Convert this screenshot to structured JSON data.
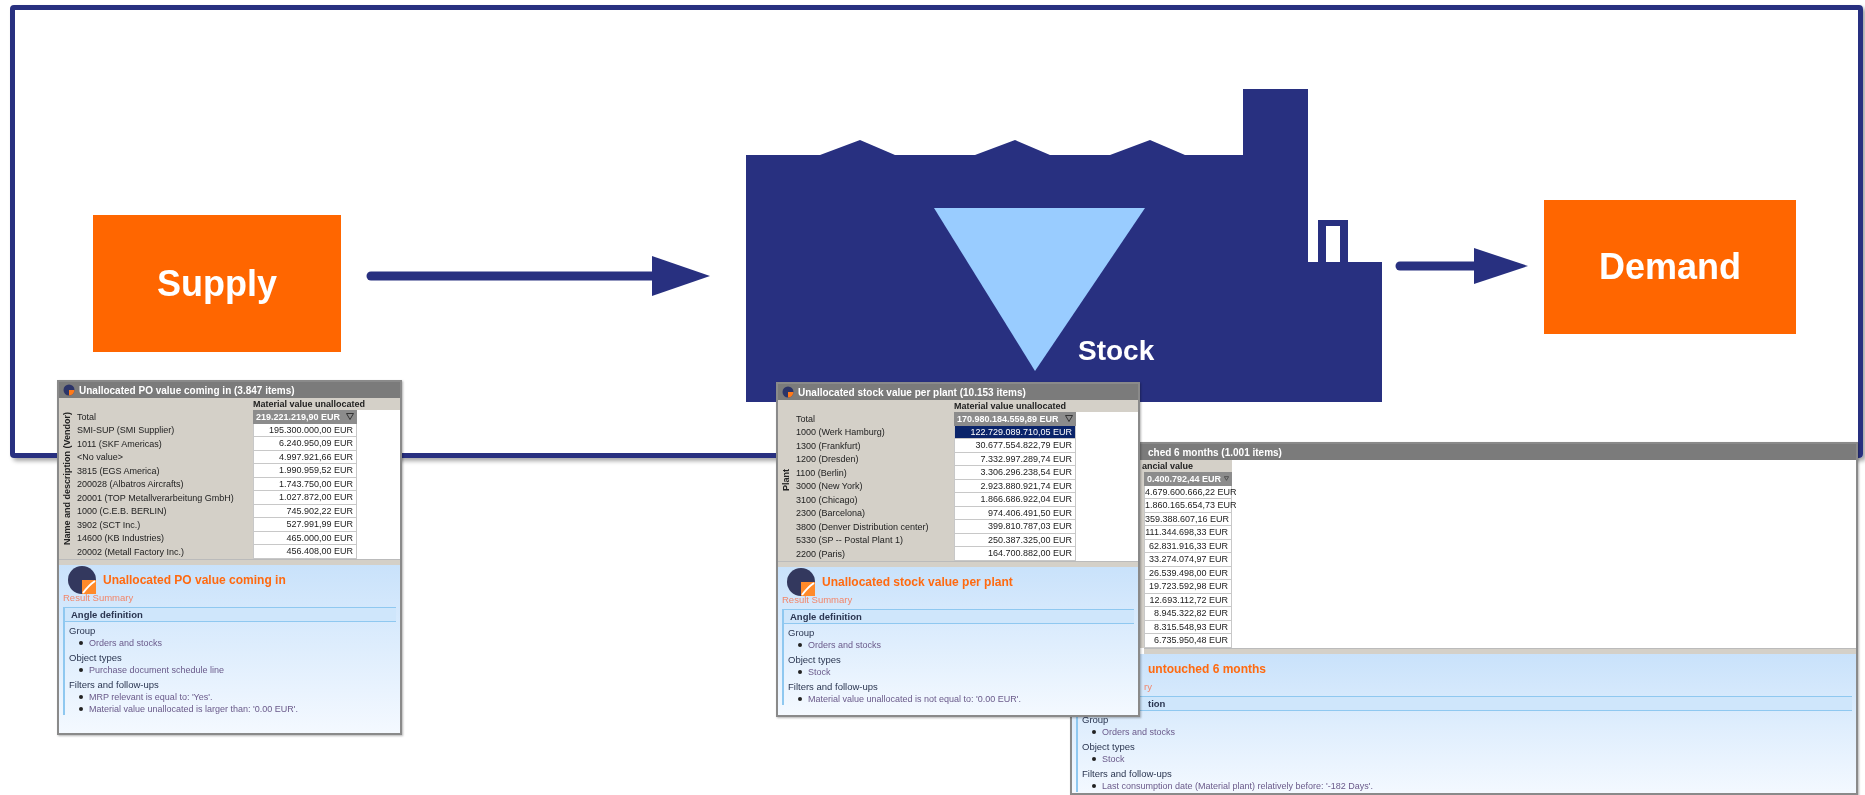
{
  "diagram": {
    "supply": "Supply",
    "stock": "Stock",
    "demand": "Demand"
  },
  "windows": [
    {
      "title": "Unallocated PO value coming in (3.847 items)",
      "axis_label": "Name and description (Vendor)",
      "column_header": "Material value unallocated",
      "total_label": "Total",
      "total": "219.221.219,90 EUR",
      "rows": [
        {
          "label": "SMI-SUP (SMI Supplier)",
          "value": "195.300.000,00 EUR",
          "selected": false
        },
        {
          "label": "1011 (SKF Americas)",
          "value": "6.240.950,09 EUR",
          "selected": false
        },
        {
          "label": "<No value>",
          "value": "4.997.921,66 EUR",
          "selected": false
        },
        {
          "label": "3815 (EGS America)",
          "value": "1.990.959,52 EUR",
          "selected": false
        },
        {
          "label": "200028 (Albatros Aircrafts)",
          "value": "1.743.750,00 EUR",
          "selected": false
        },
        {
          "label": "20001 (TOP Metallverarbeitung GmbH)",
          "value": "1.027.872,00 EUR",
          "selected": false
        },
        {
          "label": "1000 (C.E.B. BERLIN)",
          "value": "745.902,22 EUR",
          "selected": false
        },
        {
          "label": "3902 (SCT Inc.)",
          "value": "527.991,99 EUR",
          "selected": false
        },
        {
          "label": "14600 (KB Industries)",
          "value": "465.000,00 EUR",
          "selected": false
        },
        {
          "label": "20002 (Metall Factory Inc.)",
          "value": "456.408,00 EUR",
          "selected": false
        }
      ],
      "summary": {
        "title": "Unallocated PO value coming in",
        "subtitle": "Result Summary",
        "section": "Angle definition",
        "groups": [
          {
            "heading": "Group",
            "items": [
              "Orders and stocks"
            ]
          },
          {
            "heading": "Object types",
            "items": [
              "Purchase document schedule line"
            ]
          },
          {
            "heading": "Filters and follow-ups",
            "items": [
              "MRP relevant is equal to: 'Yes'.",
              "Material value unallocated is larger than: '0.00 EUR'."
            ]
          }
        ]
      }
    },
    {
      "title": "Unallocated stock value per plant (10.153 items)",
      "axis_label": "Plant",
      "column_header": "Material value unallocated",
      "total_label": "Total",
      "total": "170.980.184.559,89 EUR",
      "rows": [
        {
          "label": "1000 (Werk Hamburg)",
          "value": "122.729.089.710,05 EUR",
          "selected": true
        },
        {
          "label": "1300 (Frankfurt)",
          "value": "30.677.554.822,79 EUR",
          "selected": false
        },
        {
          "label": "1200 (Dresden)",
          "value": "7.332.997.289,74 EUR",
          "selected": false
        },
        {
          "label": "1100 (Berlin)",
          "value": "3.306.296.238,54 EUR",
          "selected": false
        },
        {
          "label": "3000 (New York)",
          "value": "2.923.880.921,74 EUR",
          "selected": false
        },
        {
          "label": "3100 (Chicago)",
          "value": "1.866.686.922,04 EUR",
          "selected": false
        },
        {
          "label": "2300 (Barcelona)",
          "value": "974.406.491,50 EUR",
          "selected": false
        },
        {
          "label": "3800 (Denver Distribution center)",
          "value": "399.810.787,03 EUR",
          "selected": false
        },
        {
          "label": "5330 (SP -- Postal Plant 1)",
          "value": "250.387.325,00 EUR",
          "selected": false
        },
        {
          "label": "2200 (Paris)",
          "value": "164.700.882,00 EUR",
          "selected": false
        }
      ],
      "summary": {
        "title": "Unallocated stock value per plant",
        "subtitle": "Result Summary",
        "section": "Angle definition",
        "groups": [
          {
            "heading": "Group",
            "items": [
              "Orders and stocks"
            ]
          },
          {
            "heading": "Object types",
            "items": [
              "Stock"
            ]
          },
          {
            "heading": "Filters and follow-ups",
            "items": [
              "Material value unallocated is not equal to: '0.00 EUR'."
            ]
          }
        ]
      }
    },
    {
      "title": "ched 6 months (1.001 items)",
      "column_header": "ancial value",
      "total": "0.400.792,44 EUR",
      "rows": [
        {
          "value": "4.679.600.666,22 EUR",
          "selected": false
        },
        {
          "value": "1.860.165.654,73 EUR",
          "selected": false
        },
        {
          "value": "359.388.607,16 EUR",
          "selected": false
        },
        {
          "value": "111.344.698,33 EUR",
          "selected": false
        },
        {
          "value": "62.831.916,33 EUR",
          "selected": false
        },
        {
          "value": "33.274.074,97 EUR",
          "selected": false
        },
        {
          "value": "26.539.498,00 EUR",
          "selected": false
        },
        {
          "value": "19.723.592,98 EUR",
          "selected": false
        },
        {
          "value": "12.693.112,72 EUR",
          "selected": false
        },
        {
          "value": "8.945.322,82 EUR",
          "selected": false
        },
        {
          "value": "8.315.548,93 EUR",
          "selected": false
        },
        {
          "value": "6.735.950,48 EUR",
          "selected": false
        }
      ],
      "summary": {
        "title": "untouched 6 months",
        "subtitle": "ry",
        "section": "tion",
        "groups": [
          {
            "heading": "Group",
            "items": [
              "Orders and stocks"
            ]
          },
          {
            "heading": "Object types",
            "items": [
              "Stock"
            ]
          },
          {
            "heading": "Filters and follow-ups",
            "items": [
              "Last consumption date (Material plant) relatively before: '-182 Days'."
            ]
          }
        ]
      }
    }
  ]
}
